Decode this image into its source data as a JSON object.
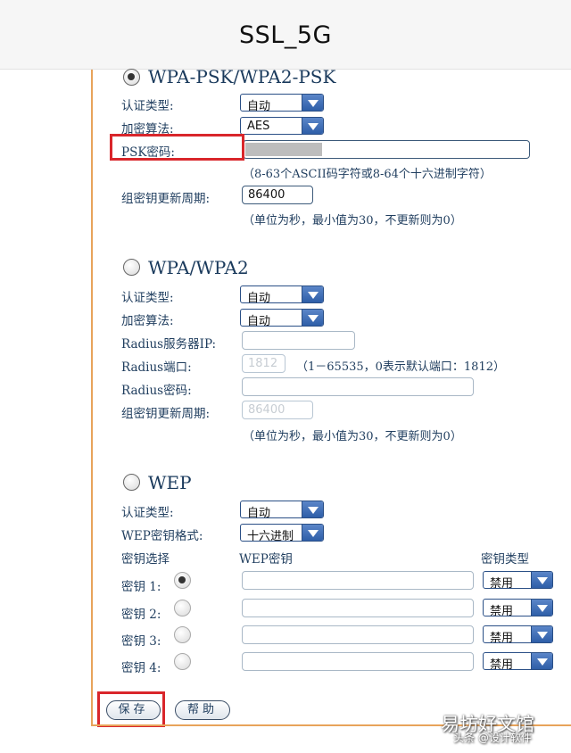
{
  "header": {
    "title": "SSL_5G"
  },
  "wpa_psk": {
    "title": "WPA-PSK/WPA2-PSK",
    "auth_label": "认证类型:",
    "auth_value": "自动",
    "enc_label": "加密算法:",
    "enc_value": "AES",
    "psk_label": "PSK密码:",
    "psk_value": "",
    "psk_hint": "（8-63个ASCII码字符或8-64个十六进制字符）",
    "rekey_label": "组密钥更新周期:",
    "rekey_value": "86400",
    "rekey_hint": "（单位为秒，最小值为30，不更新则为0）"
  },
  "wpa": {
    "title": "WPA/WPA2",
    "auth_label": "认证类型:",
    "auth_value": "自动",
    "enc_label": "加密算法:",
    "enc_value": "自动",
    "radius_ip_label": "Radius服务器IP:",
    "radius_port_label": "Radius端口:",
    "radius_port_value": "1812",
    "radius_port_hint": "（1－65535，0表示默认端口：1812）",
    "radius_pwd_label": "Radius密码:",
    "rekey_label": "组密钥更新周期:",
    "rekey_value": "86400",
    "rekey_hint": "（单位为秒，最小值为30，不更新则为0）"
  },
  "wep": {
    "title": "WEP",
    "auth_label": "认证类型:",
    "auth_value": "自动",
    "format_label": "WEP密钥格式:",
    "format_value": "十六进制",
    "col_select": "密钥选择",
    "col_key": "WEP密钥",
    "col_type": "密钥类型",
    "keys": [
      {
        "label": "密钥 1:",
        "type": "禁用",
        "selected": true
      },
      {
        "label": "密钥 2:",
        "type": "禁用",
        "selected": false
      },
      {
        "label": "密钥 3:",
        "type": "禁用",
        "selected": false
      },
      {
        "label": "密钥 4:",
        "type": "禁用",
        "selected": false
      }
    ]
  },
  "buttons": {
    "save": "保存",
    "help": "帮助"
  },
  "watermark": {
    "brand": "易坊好文馆",
    "sub": "头条 @设计软件"
  },
  "colors": {
    "frame": "#e8a35a",
    "highlight": "#d9262b",
    "select_arrow": "#2e5ea8",
    "text": "#1f3d5e"
  }
}
